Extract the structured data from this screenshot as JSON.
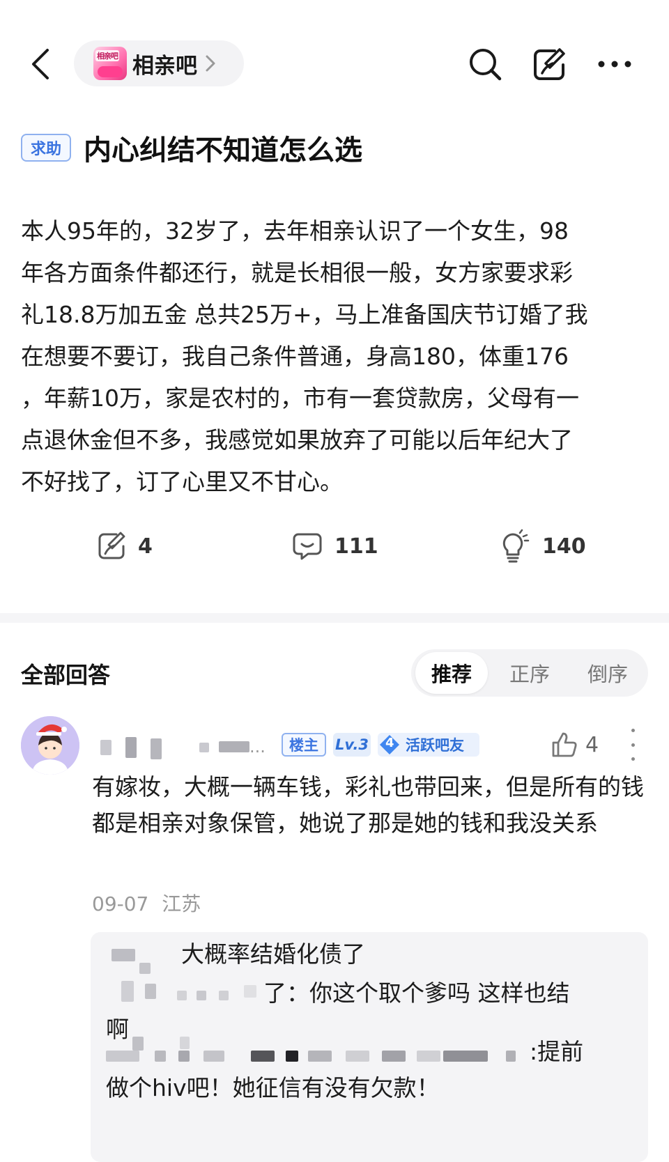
{
  "header": {
    "forum_name": "相亲吧",
    "forum_logo_text": "相亲吧"
  },
  "post": {
    "tag": "求助",
    "title": "内心纠结不知道怎么选",
    "body": "本人95年的，32岁了，去年相亲认识了一个女生，98\n年各方面条件都还行，就是长相很一般，女方家要求彩\n礼18.8万加五金 总共25万+，马上准备国庆节订婚了我\n在想要不要订，我自己条件普通，身高180，体重176\n，年薪10万，家是农村的，市有一套贷款房，父母有一\n点退休金但不多，我感觉如果放弃了可能以后年纪大了\n不好找了，订了心里又不甘心。",
    "share_count": "4",
    "comment_count": "111",
    "like_count": "140"
  },
  "answers": {
    "title": "全部回答",
    "sort_options": [
      "推荐",
      "正序",
      "倒序"
    ],
    "selected_sort": "推荐"
  },
  "comment": {
    "badge_owner": "楼主",
    "badge_level": "Lv.3",
    "badge_active_level": "4",
    "badge_active_label": "活跃吧友",
    "name_suffix": "...",
    "like_count": "4",
    "text": "有嫁妆，大概一辆车钱，彩礼也带回来，但是所有的钱都是相亲对象保管，她说了那是她的钱和我没关系",
    "date": "09-07",
    "location": "江苏",
    "replies": [
      {
        "text": "大概率结婚化债了"
      },
      {
        "text_line1": "了：你这个取个爹吗 这样也结",
        "text_line2": "啊"
      },
      {
        "text_line1": ":提前",
        "text_line2": "做个hiv吧！她征信有没有欠款！"
      }
    ]
  },
  "colors": {
    "accent_blue": "#3b74e0",
    "tag_border": "#8fb1ef",
    "divider": "#f5f5f7",
    "muted_text": "#999999"
  }
}
